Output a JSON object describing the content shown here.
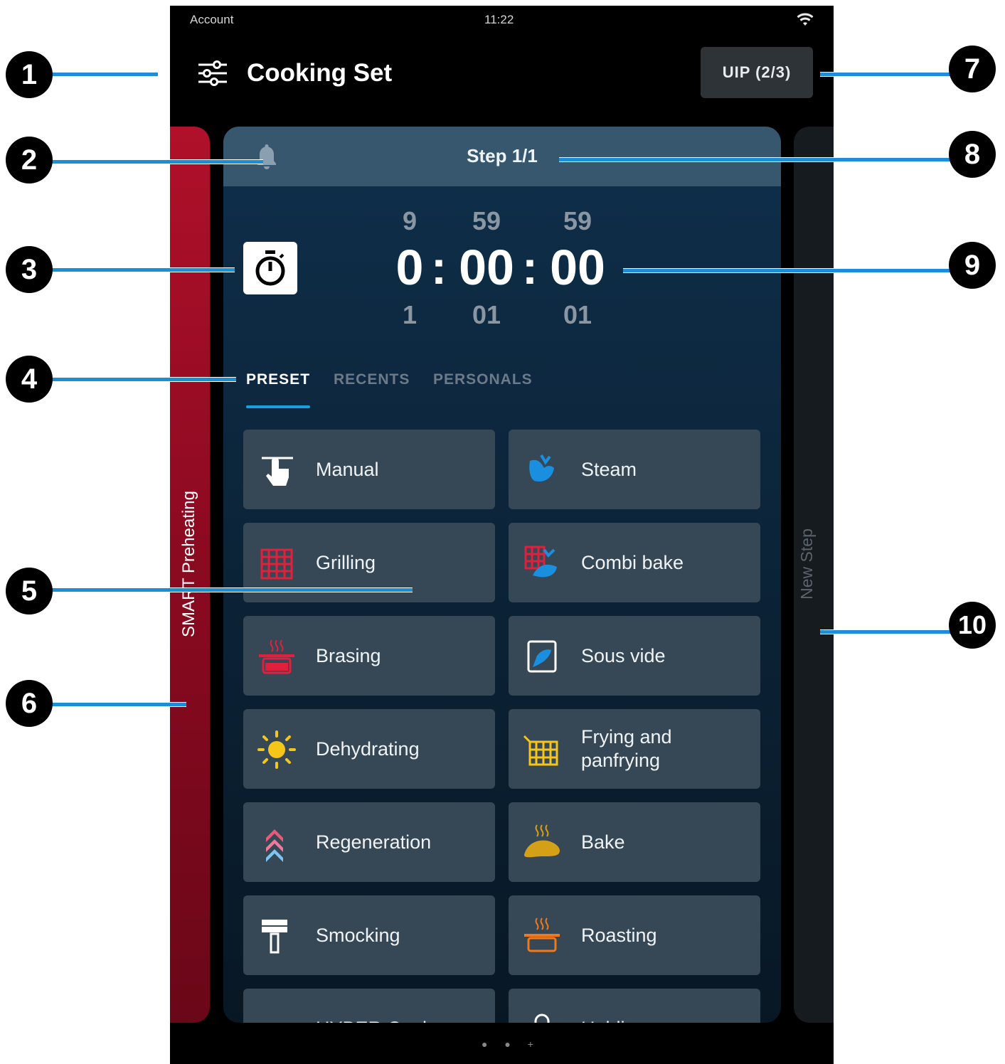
{
  "status_bar": {
    "account": "Account",
    "time": "11:22"
  },
  "header": {
    "title": "Cooking Set",
    "uip_button": "UIP (2/3)"
  },
  "side_panels": {
    "left_label": "SMART Preheating",
    "right_label": "New Step"
  },
  "step": {
    "label": "Step 1/1"
  },
  "timer": {
    "hours": {
      "above": "9",
      "value": "0",
      "below": "1"
    },
    "minutes": {
      "above": "59",
      "value": "00",
      "below": "01"
    },
    "seconds": {
      "above": "59",
      "value": "00",
      "below": "01"
    },
    "separator": ":"
  },
  "tabs": [
    {
      "label": "PRESET",
      "active": true
    },
    {
      "label": "RECENTS",
      "active": false
    },
    {
      "label": "PERSONALS",
      "active": false
    }
  ],
  "presets": [
    {
      "label": "Manual",
      "icon": "hand-touch-icon"
    },
    {
      "label": "Steam",
      "icon": "steam-icon"
    },
    {
      "label": "Grilling",
      "icon": "grill-icon"
    },
    {
      "label": "Combi bake",
      "icon": "combi-bake-icon"
    },
    {
      "label": "Brasing",
      "icon": "braising-pot-icon"
    },
    {
      "label": "Sous vide",
      "icon": "sous-vide-icon"
    },
    {
      "label": "Dehydrating",
      "icon": "sun-icon"
    },
    {
      "label": "Frying and panfrying",
      "icon": "fryer-basket-icon"
    },
    {
      "label": "Regeneration",
      "icon": "regeneration-chevrons-icon"
    },
    {
      "label": "Bake",
      "icon": "bread-icon"
    },
    {
      "label": "Smocking",
      "icon": "smoke-icon"
    },
    {
      "label": "Roasting",
      "icon": "roasting-pot-icon"
    },
    {
      "label": "HYBER Cook",
      "icon": "hyber-wave-icon"
    },
    {
      "label": "Holding",
      "icon": "lock-icon"
    }
  ],
  "pager": "● ● +",
  "callouts": [
    "1",
    "2",
    "3",
    "4",
    "5",
    "6",
    "7",
    "8",
    "9",
    "10"
  ],
  "colors": {
    "accent": "#1aa0e0",
    "card": "#0f2f4b",
    "tile": "#364856",
    "smart_red": "#a3102a"
  }
}
